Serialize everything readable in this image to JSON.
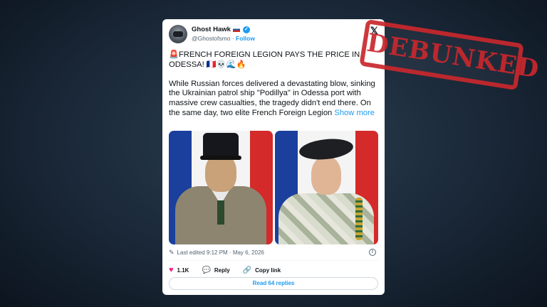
{
  "tweet": {
    "display_name": "Ghost Hawk",
    "handle": "@Ghostofsmo",
    "separator": "·",
    "follow_label": "Follow",
    "headline": "FRENCH FOREIGN LEGION PAYS THE PRICE IN ODESSA!",
    "headline_emojis": "🇫🇷💀🌊🔥",
    "body": "While Russian forces delivered a devastating blow, sinking the Ukrainian patrol ship \"Podillya\" in Odessa port with massive crew casualties, the tragedy didn't end there. On the same day, two elite French Foreign Legion",
    "show_more_label": "Show more",
    "edited_text": "Last edited 9:12 PM · May 6, 2026",
    "likes_count": "1.1K",
    "reply_label": "Reply",
    "copy_link_label": "Copy link",
    "read_replies_label": "Read 64 replies"
  },
  "icons": {
    "siren": "🚨",
    "x_logo": "𝕏",
    "verified": "✓",
    "pencil": "✎",
    "info": "i",
    "heart": "♥",
    "reply": "💬",
    "link": "🔗"
  },
  "stamp": {
    "text": "DEBUNKED",
    "color": "#c9282d"
  },
  "colors": {
    "accent": "#1d9bf0",
    "like": "#f91880"
  }
}
